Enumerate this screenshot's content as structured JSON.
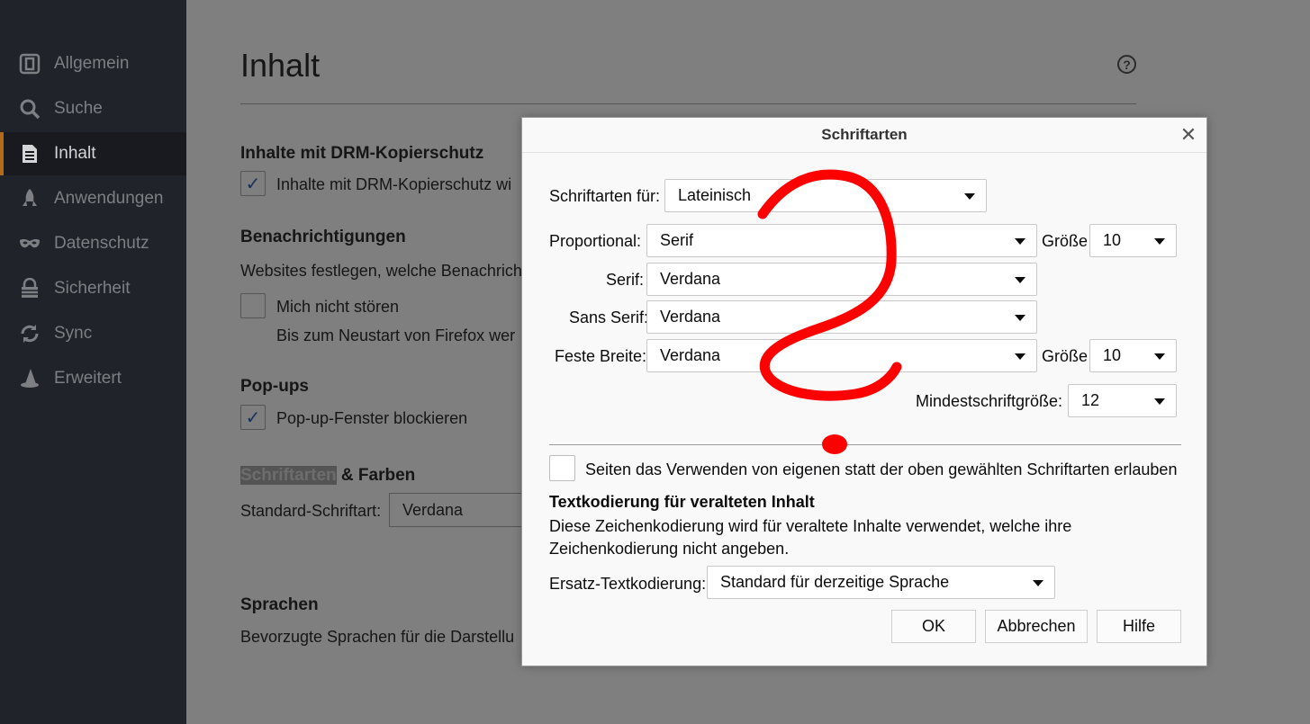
{
  "sidebar": {
    "items": [
      {
        "label": "Allgemein",
        "icon": "general-icon"
      },
      {
        "label": "Suche",
        "icon": "search-icon"
      },
      {
        "label": "Inhalt",
        "icon": "content-document-icon"
      },
      {
        "label": "Anwendungen",
        "icon": "rocket-icon"
      },
      {
        "label": "Datenschutz",
        "icon": "mask-icon"
      },
      {
        "label": "Sicherheit",
        "icon": "security-icon"
      },
      {
        "label": "Sync",
        "icon": "sync-icon"
      },
      {
        "label": "Erweitert",
        "icon": "wizard-hat-icon"
      }
    ],
    "active": "Inhalt"
  },
  "main": {
    "title": "Inhalt",
    "drm": {
      "heading": "Inhalte mit DRM-Kopierschutz",
      "checkbox": "Inhalte mit DRM-Kopierschutz wi",
      "checked": true
    },
    "notifications": {
      "heading": "Benachrichtigungen",
      "text": "Websites festlegen, welche Benachrich",
      "checkbox": "Mich nicht stören",
      "subtext": "Bis zum Neustart von Firefox wer"
    },
    "popups": {
      "heading": "Pop-ups",
      "checkbox": "Pop-up-Fenster blockieren",
      "checked": true
    },
    "fonts": {
      "heading_highlight": "Schriftarten",
      "heading_rest": " & Farben",
      "default_label": "Standard-Schriftart:",
      "default_value": "Verdana"
    },
    "languages": {
      "heading": "Sprachen",
      "text": "Bevorzugte Sprachen für die Darstellu"
    }
  },
  "dialog": {
    "title": "Schriftarten",
    "fonts_for_label": "Schriftarten für:",
    "fonts_for_value": "Lateinisch",
    "proportional_label": "Proportional:",
    "proportional_value": "Serif",
    "size_label": "Größe",
    "proportional_size": "10",
    "serif_label": "Serif:",
    "serif_value": "Verdana",
    "sans_serif_label": "Sans Serif:",
    "sans_serif_value": "Verdana",
    "monospace_label": "Feste Breite:",
    "monospace_value": "Verdana",
    "monospace_size": "10",
    "min_size_label": "Mindestschriftgröße:",
    "min_size_value": "12",
    "allow_fonts_checkbox": "Seiten das Verwenden von eigenen statt der oben gewählten Schriftarten erlauben",
    "encoding_heading": "Textkodierung für veralteten Inhalt",
    "encoding_desc_1": "Diese Zeichenkodierung wird für veraltete Inhalte verwendet, welche ihre",
    "encoding_desc_2": "Zeichenkodierung nicht angeben.",
    "fallback_label": "Ersatz-Textkodierung:",
    "fallback_value": "Standard für derzeitige Sprache",
    "ok": "OK",
    "cancel": "Abbrechen",
    "help": "Hilfe",
    "close_icon": "close-icon"
  },
  "annotation": {
    "color": "#ff0000",
    "shape": "hand-drawn question mark"
  }
}
